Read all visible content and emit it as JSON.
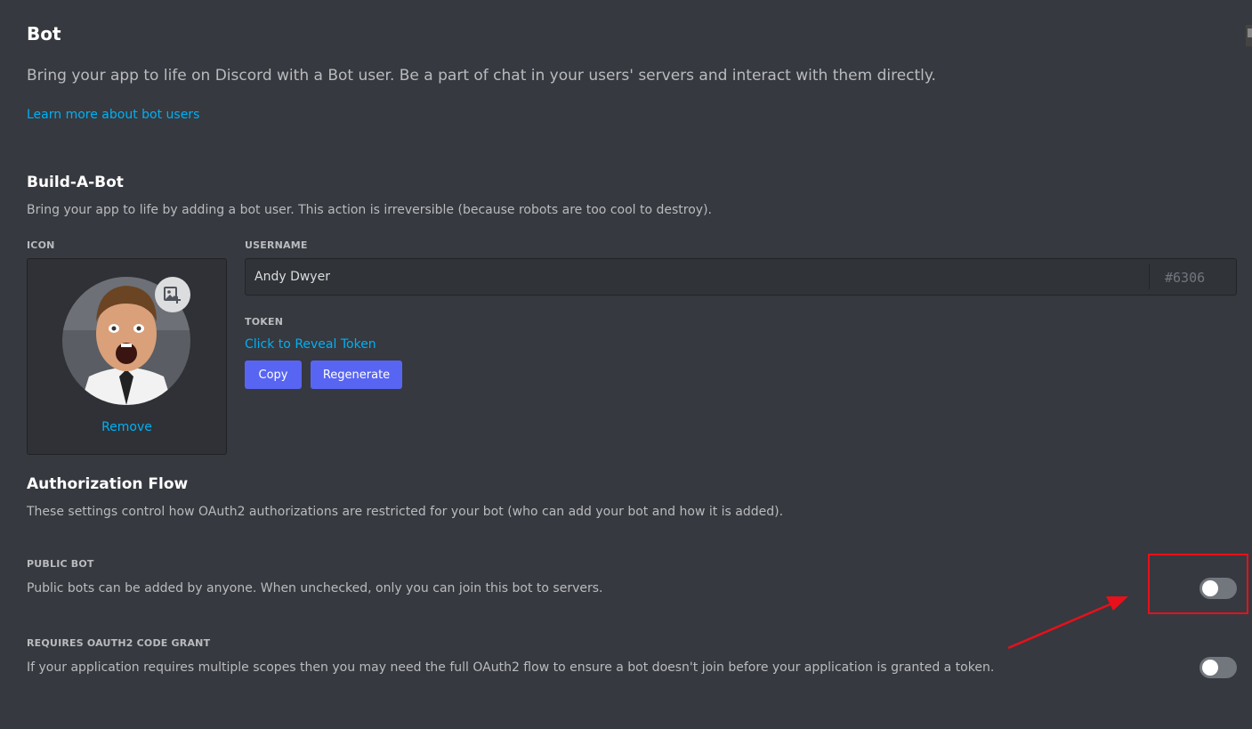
{
  "header": {
    "title": "Bot",
    "lead": "Bring your app to life on Discord with a Bot user. Be a part of chat in your users' servers and interact with them directly.",
    "learn_more": "Learn more about bot users"
  },
  "build_a_bot": {
    "title": "Build-A-Bot",
    "description": "Bring your app to life by adding a bot user. This action is irreversible (because robots are too cool to destroy).",
    "icon_label": "ICON",
    "remove_label": "Remove",
    "username_label": "USERNAME",
    "username_value": "Andy Dwyer",
    "discriminator": "#6306",
    "token_label": "TOKEN",
    "reveal_token": "Click to Reveal Token",
    "copy_label": "Copy",
    "regenerate_label": "Regenerate"
  },
  "authorization_flow": {
    "title": "Authorization Flow",
    "description": "These settings control how OAuth2 authorizations are restricted for your bot (who can add your bot and how it is added).",
    "public_bot": {
      "label": "PUBLIC BOT",
      "description": "Public bots can be added by anyone. When unchecked, only you can join this bot to servers.",
      "enabled": false
    },
    "code_grant": {
      "label": "REQUIRES OAUTH2 CODE GRANT",
      "description": "If your application requires multiple scopes then you may need the full OAuth2 flow to ensure a bot doesn't join before your application is granted a token.",
      "enabled": false
    }
  },
  "colors": {
    "background": "#36393f",
    "link": "#00b0f4",
    "button": "#5865f2",
    "annotation": "#e8101a"
  }
}
